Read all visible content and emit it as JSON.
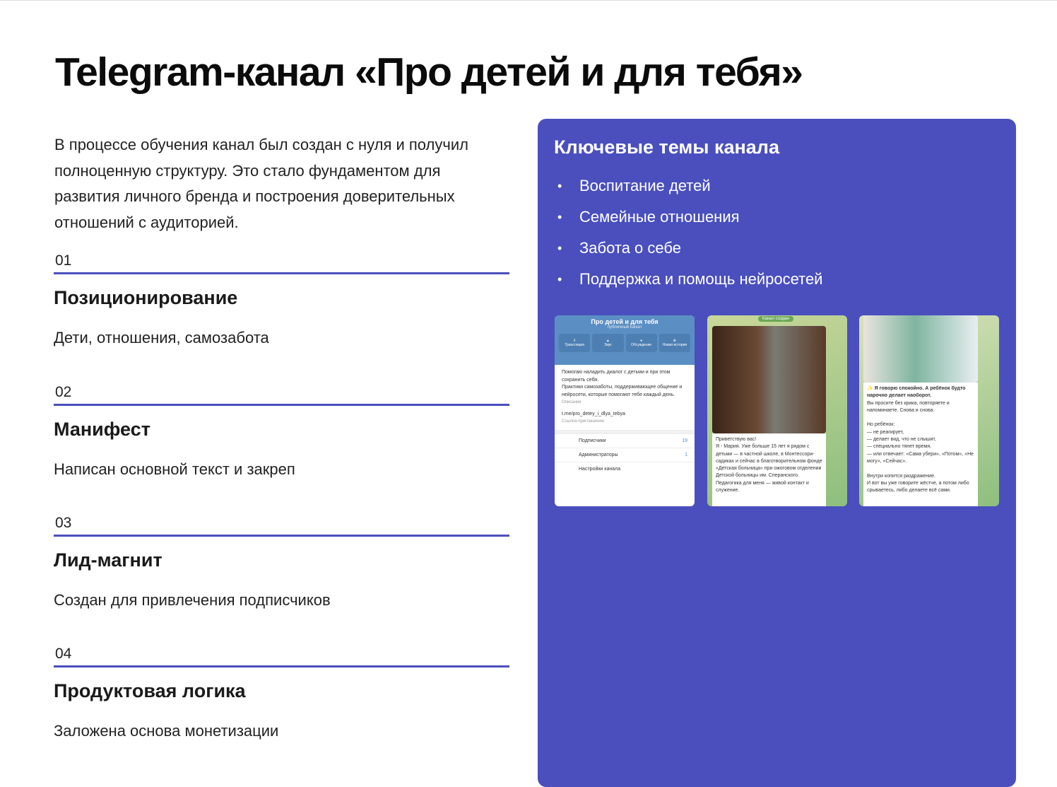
{
  "title": "Telegram-канал «Про детей и для тебя»",
  "intro": "В процессе обучения канал был создан с нуля и получил полноценную структуру. Это стало фундаментом для развития личного бренда и построения доверительных отношений с аудиторией.",
  "steps": [
    {
      "num": "01",
      "title": "Позиционирование",
      "desc": "Дети, отношения, самозабота"
    },
    {
      "num": "02",
      "title": "Манифест",
      "desc": "Написан основной текст и закреп"
    },
    {
      "num": "03",
      "title": "Лид-магнит",
      "desc": "Создан для привлечения подписчиков"
    },
    {
      "num": "04",
      "title": "Продуктовая логика",
      "desc": "Заложена основа монетизации"
    }
  ],
  "panel": {
    "title": "Ключевые темы канала",
    "bullet": "•",
    "topics": [
      "Воспитание детей",
      "Семейные отношения",
      "Забота о себе",
      "Поддержка и помощь нейросетей"
    ]
  },
  "shot1": {
    "name": "Про детей и для тебя",
    "type": "публичный канал",
    "buttons": [
      "Трансляция",
      "Звук",
      "Обсуждение",
      "Новая история"
    ],
    "description": "Помогаю наладить диалог с детьми и при этом сохранить себя.\nПрактики самозаботы, поддерживающее общение и нейросети, которые помогают тебе каждый день.",
    "description_label": "Описание",
    "link": "t.me/pro_detey_i_dlya_tebya",
    "link_label": "Ссылка-приглашение",
    "rows": [
      {
        "label": "Подписчики",
        "value": "19"
      },
      {
        "label": "Администраторы",
        "value": "1"
      },
      {
        "label": "Настройки канала",
        "value": ""
      }
    ]
  },
  "shot2": {
    "badge": "Канал создан",
    "text": "Приветствую вас!\nЯ - Мария. Уже больше 15 лет я рядом с детьми — в частной школе, в Монтессори-садиках и сейчас в благотворительном фонде «Детская больница» при ожоговом отделении Детской больницы им. Сперанского.\nПедагогика для меня — живой контакт и служение."
  },
  "shot3": {
    "headline": "✨ Я говорю спокойно. А ребёнок будто нарочно делает наоборот.",
    "text": "Вы просите без крика, повторяете и напоминаете. Снова и снова.\n\nНо ребёнок:\n— не реагирует,\n— делает вид, что не слышит,\n— специально тянет время,\n— или отвечает: «Сама убери», «Потом», «Не могу», «Сейчас».\n\nВнутри копится раздражение.\nИ вот вы уже говорите жёстче, а потом либо срываетесь, либо делаете всё сами."
  },
  "colors": {
    "accent": "#4a4fbd"
  }
}
